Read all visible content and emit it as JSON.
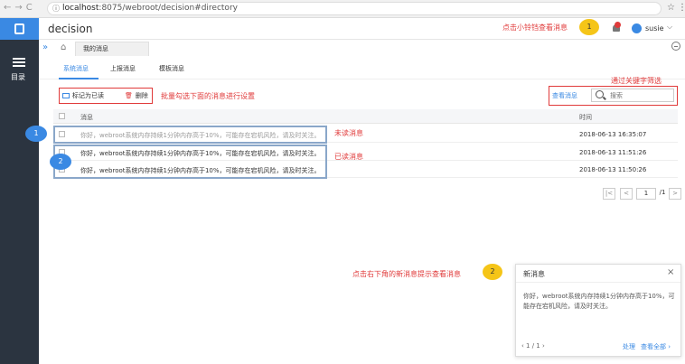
{
  "browser": {
    "url_host": "localhost",
    "url_rest": ":8075/webroot/decision#directory"
  },
  "sidebar": {
    "directory_label": "目录"
  },
  "header": {
    "title": "decision",
    "username": "susie"
  },
  "tabs": {
    "active_tab": "我的消息"
  },
  "subtabs": [
    "系统消息",
    "上报消息",
    "模板消息"
  ],
  "toolbar": {
    "mark_read": "标记为已读",
    "delete": "删除",
    "view_message": "查看消息",
    "search_placeholder": "搜索"
  },
  "annotations": {
    "bell_hint": "点击小铃铛查看消息",
    "bell_num": "1",
    "filter_hint": "通过关键字筛选",
    "batch_hint": "批量勾选下面的消息进行设置",
    "unread": "未读消息",
    "read": "已读消息",
    "popup_hint": "点击右下角的新消息提示查看消息",
    "popup_num": "2",
    "row1_num": "1",
    "row2_num": "2"
  },
  "table": {
    "headers": [
      "消息",
      "时间"
    ],
    "rows": [
      {
        "message": "你好，webroot系统内存持续1分钟内存高于10%，可能存在宕机风险，请及时关注。",
        "time": "2018-06-13 16:35:07",
        "status": "unread"
      },
      {
        "message": "你好，webroot系统内存持续1分钟内存高于10%，可能存在宕机风险，请及时关注。",
        "time": "2018-06-13 11:51:26",
        "status": "read"
      },
      {
        "message": "你好，webroot系统内存持续1分钟内存高于10%，可能存在宕机风险，请及时关注。",
        "time": "2018-06-13 11:50:26",
        "status": "read"
      }
    ]
  },
  "pagination": {
    "first": "|<",
    "prev": "<",
    "current": "1",
    "total": "/1",
    "next": ">",
    "last": ">|"
  },
  "popup": {
    "title": "新消息",
    "close": "×",
    "body": "你好，webroot系统内存持续1分钟内存高于10%，可能存在宕机风险，请及时关注。",
    "page": "‹  1 / 1  ›",
    "handle": "处理",
    "view_all": "查看全部 ›"
  },
  "colors": {
    "accent": "#3a89e3",
    "annotation": "#e03a3a",
    "sidebar": "#2b3440",
    "highlight_badge": "#f5c518"
  }
}
